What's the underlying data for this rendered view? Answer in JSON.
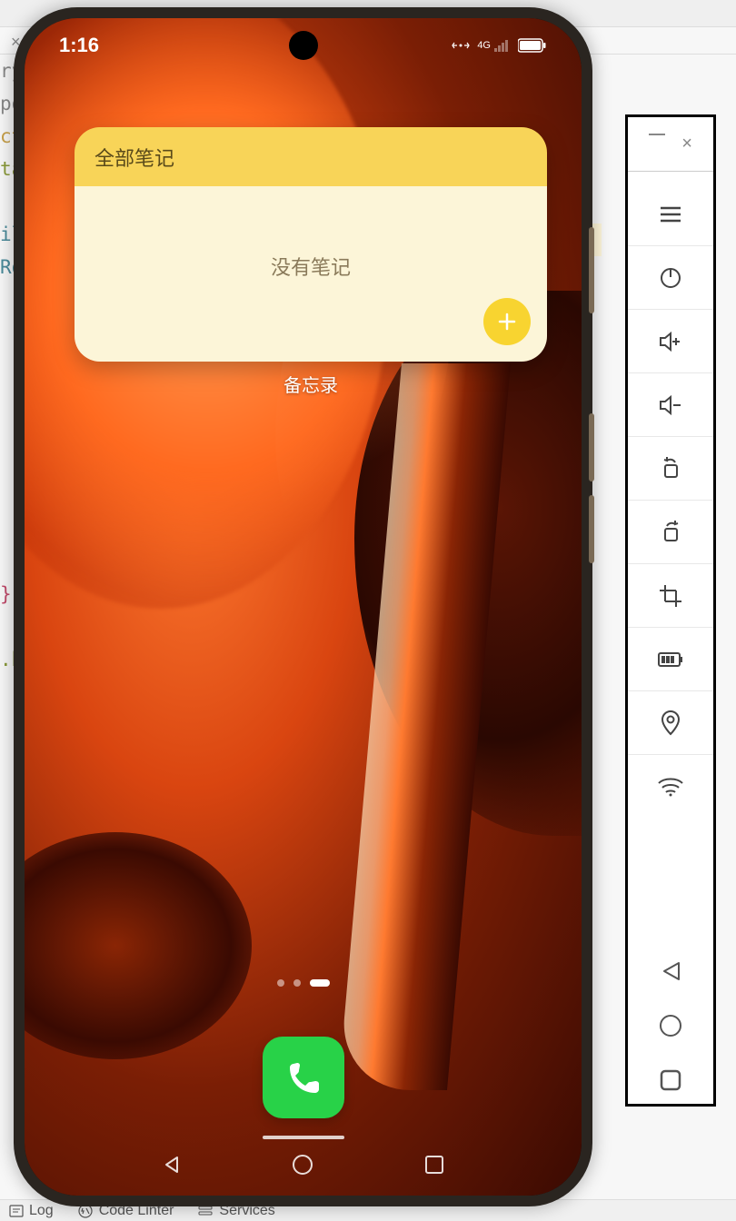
{
  "status_bar": {
    "time": "1:16",
    "network_type": "4G"
  },
  "notes_widget": {
    "header": "全部笔记",
    "empty_text": "没有笔记",
    "label": "备忘录"
  },
  "ide": {
    "code_fragments": {
      "l1": "ry",
      "l2": "po",
      "l3": "ct",
      "l4": "ta",
      "l5": "il",
      "l6": "Ro",
      "l7": "}",
      "l8": ".h"
    },
    "bottom_tabs": {
      "log": "Log",
      "code_linter": "Code Linter",
      "services": "Services"
    }
  }
}
